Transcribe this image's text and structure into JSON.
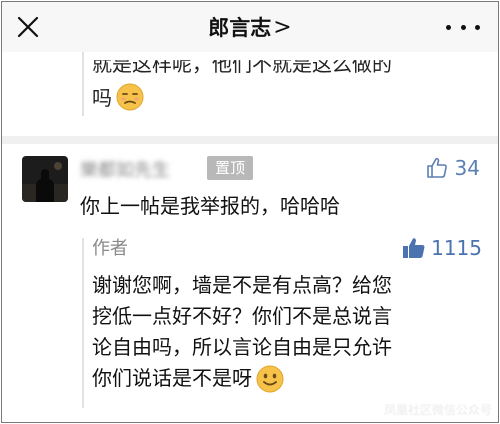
{
  "topbar": {
    "title": "郎言志",
    "chevron": ">"
  },
  "previous_reply": {
    "line1": "就是这样呢，他们不就是这么做的",
    "line2": "吗",
    "emoji": "unamused-face-icon"
  },
  "comment": {
    "username": "樂都如先生",
    "pin_badge": "置顶",
    "like_count": "34",
    "text": "你上一帖是我举报的，哈哈哈"
  },
  "author_reply": {
    "label": "作者",
    "like_count": "1115",
    "lines": [
      "谢谢您啊，墙是不是有点高？给您",
      "挖低一点好不好？你们不是总说言",
      "论自由吗，所以言论自由是只允许",
      "你们说话是不是呀"
    ],
    "end_emoji": "smile-face-icon"
  },
  "watermark": "凤凰社区微信公众号",
  "colors": {
    "like_blue": "#5b7fb5",
    "badge_gray": "#b8b8b8",
    "topbar_bg": "#f7f7f7"
  }
}
